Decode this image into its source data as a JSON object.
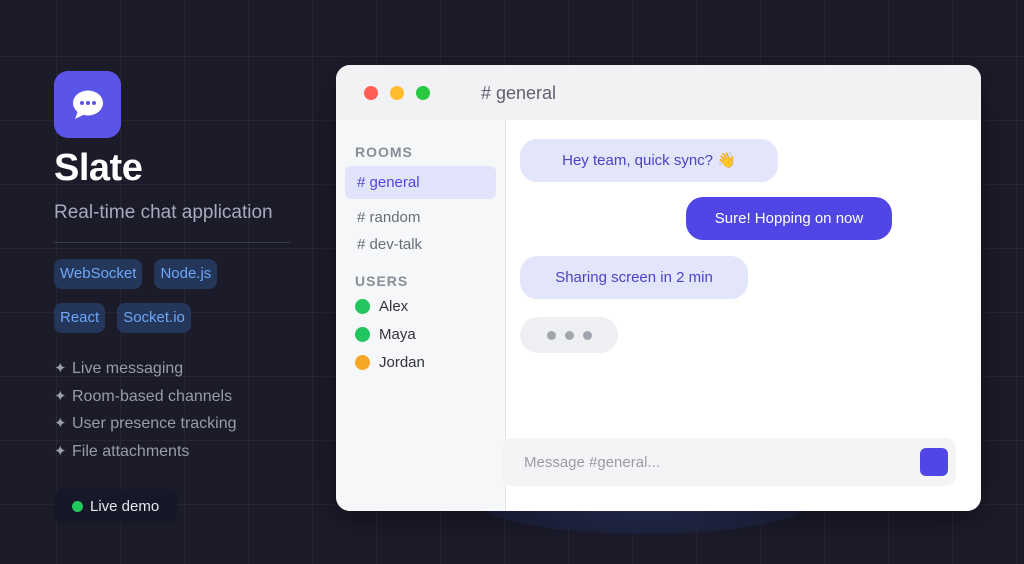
{
  "app": {
    "name": "Slate",
    "tagline": "Real-time chat application",
    "accent_color": "#5b54e8",
    "icon": "chat-bubble-icon"
  },
  "tech_tags": [
    "WebSocket",
    "Node.js",
    "React",
    "Socket.io"
  ],
  "features": [
    "Live messaging",
    "Room-based channels",
    "User presence tracking",
    "File attachments"
  ],
  "feature_bullet": "✦",
  "live_demo": {
    "label": "Live demo",
    "status_color": "#22c55e"
  },
  "window": {
    "title": "# general",
    "controls": [
      "close",
      "minimize",
      "maximize"
    ]
  },
  "sidebar": {
    "rooms_label": "ROOMS",
    "rooms": [
      {
        "label": "# general",
        "active": true
      },
      {
        "label": "# random",
        "active": false
      },
      {
        "label": "# dev-talk",
        "active": false
      }
    ],
    "users_label": "USERS",
    "users": [
      {
        "name": "Alex",
        "status_color": "#22c55e"
      },
      {
        "name": "Maya",
        "status_color": "#22c55e"
      },
      {
        "name": "Jordan",
        "status_color": "#f5a623"
      }
    ]
  },
  "messages": [
    {
      "text": "Hey team, quick sync? 👋",
      "direction": "incoming"
    },
    {
      "text": "Sure! Hopping on now",
      "direction": "outgoing"
    },
    {
      "text": "Sharing screen in 2 min",
      "direction": "incoming"
    }
  ],
  "composer": {
    "placeholder": "Message #general...",
    "value": ""
  }
}
